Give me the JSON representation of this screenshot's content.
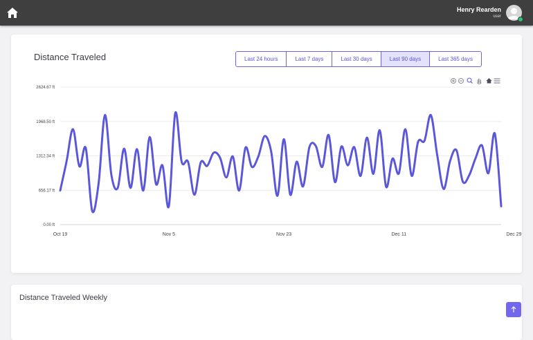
{
  "header": {
    "user_name": "Henry Rearden",
    "user_role": "user"
  },
  "card1": {
    "title": "Distance Traveled",
    "ranges": [
      {
        "label": "Last 24 hours",
        "active": false
      },
      {
        "label": "Last 7 days",
        "active": false
      },
      {
        "label": "Last 30 days",
        "active": false
      },
      {
        "label": "Last 90 days",
        "active": true
      },
      {
        "label": "Last 365 days",
        "active": false
      }
    ]
  },
  "card2": {
    "title": "Distance Traveled Weekly"
  },
  "colors": {
    "accent": "#5b57d9",
    "topbar": "#3f3f3f",
    "scroll_button": "#7367f0"
  },
  "chart_data": {
    "type": "line",
    "ylim": [
      0,
      2624.67
    ],
    "y_ticks": [
      "0.00 ft",
      "656.17 ft",
      "1312.34 ft",
      "1968.50 ft",
      "2624.67 ft"
    ],
    "x_ticks": [
      "Oct 19",
      "Nov 5",
      "Nov 23",
      "Dec 11",
      "Dec 29"
    ],
    "x_tick_day_index": [
      0,
      17,
      35,
      53,
      71
    ],
    "grid": true,
    "series": [
      {
        "values": [
          650,
          1210,
          1820,
          1110,
          1460,
          260,
          780,
          2090,
          950,
          700,
          1450,
          700,
          1440,
          650,
          1670,
          770,
          1130,
          350,
          2130,
          1200,
          1200,
          570,
          1190,
          1120,
          1370,
          1280,
          900,
          1300,
          650,
          1470,
          1100,
          1300,
          1690,
          1400,
          550,
          1630,
          570,
          1200,
          730,
          1480,
          1500,
          1100,
          1710,
          810,
          1490,
          1130,
          1480,
          930,
          1660,
          970,
          1800,
          720,
          1260,
          980,
          1820,
          930,
          1580,
          1600,
          2090,
          1320,
          680,
          1210,
          1420,
          820,
          940,
          1270,
          1510,
          980,
          1740,
          350
        ]
      }
    ]
  }
}
